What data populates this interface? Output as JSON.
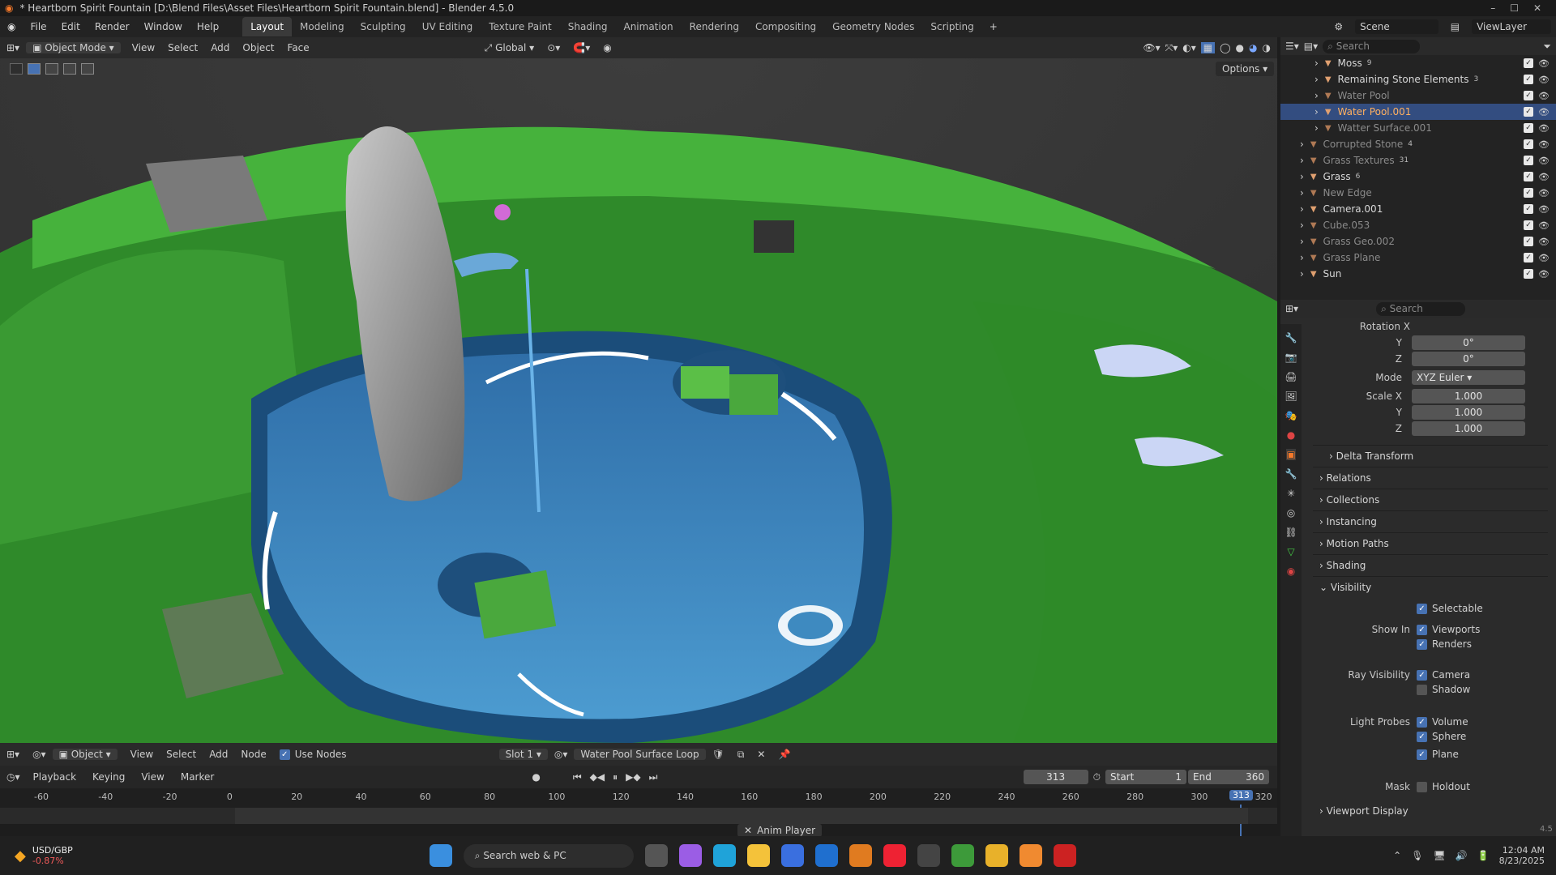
{
  "window": {
    "title": "* Heartborn Spirit Fountain [D:\\Blend Files\\Asset Files\\Heartborn Spirit Fountain.blend] - Blender 4.5.0"
  },
  "menu": [
    "File",
    "Edit",
    "Render",
    "Window",
    "Help"
  ],
  "workspaces": [
    "Layout",
    "Modeling",
    "Sculpting",
    "UV Editing",
    "Texture Paint",
    "Shading",
    "Animation",
    "Rendering",
    "Compositing",
    "Geometry Nodes",
    "Scripting"
  ],
  "active_workspace": "Layout",
  "scene": {
    "name": "Scene",
    "view_layer": "ViewLayer"
  },
  "viewport_header": {
    "mode": "Object Mode",
    "menus": [
      "View",
      "Select",
      "Add",
      "Object",
      "Face"
    ],
    "orientation": "Global",
    "options": "Options"
  },
  "outliner": {
    "search_placeholder": "Search",
    "items": [
      {
        "label": "Moss",
        "indent": 2,
        "dim": false,
        "badge": "9"
      },
      {
        "label": "Remaining Stone Elements",
        "indent": 2,
        "dim": false,
        "badge": "3"
      },
      {
        "label": "Water Pool",
        "indent": 2,
        "dim": true,
        "badge": ""
      },
      {
        "label": "Water Pool.001",
        "indent": 2,
        "dim": false,
        "badge": "",
        "selected": true
      },
      {
        "label": "Watter Surface.001",
        "indent": 2,
        "dim": true,
        "badge": ""
      },
      {
        "label": "Corrupted Stone",
        "indent": 1,
        "dim": true,
        "badge": "4"
      },
      {
        "label": "Grass Textures",
        "indent": 1,
        "dim": true,
        "badge": "31"
      },
      {
        "label": "Grass",
        "indent": 1,
        "dim": false,
        "badge": "6"
      },
      {
        "label": "New Edge",
        "indent": 1,
        "dim": true,
        "badge": ""
      },
      {
        "label": "Camera.001",
        "indent": 1,
        "dim": false,
        "badge": ""
      },
      {
        "label": "Cube.053",
        "indent": 1,
        "dim": true,
        "badge": ""
      },
      {
        "label": "Grass Geo.002",
        "indent": 1,
        "dim": true,
        "badge": ""
      },
      {
        "label": "Grass Plane",
        "indent": 1,
        "dim": true,
        "badge": ""
      },
      {
        "label": "Sun",
        "indent": 1,
        "dim": false,
        "badge": ""
      }
    ]
  },
  "properties": {
    "search_placeholder": "Search",
    "rotation_label": "Rotation X",
    "rot_y": {
      "label": "Y",
      "value": "0°"
    },
    "rot_z": {
      "label": "Z",
      "value": "0°"
    },
    "mode": {
      "label": "Mode",
      "value": "XYZ Euler"
    },
    "scale_x": {
      "label": "Scale X",
      "value": "1.000"
    },
    "scale_y": {
      "label": "Y",
      "value": "1.000"
    },
    "scale_z": {
      "label": "Z",
      "value": "1.000"
    },
    "panels": [
      "Delta Transform",
      "Relations",
      "Collections",
      "Instancing",
      "Motion Paths",
      "Shading",
      "Visibility"
    ],
    "visibility": {
      "selectable": "Selectable",
      "show_in": "Show In",
      "viewports": "Viewports",
      "renders": "Renders",
      "ray_visibility": "Ray Visibility",
      "camera": "Camera",
      "shadow": "Shadow",
      "light_probes": "Light Probes",
      "volume": "Volume",
      "sphere": "Sphere",
      "plane": "Plane",
      "mask": "Mask",
      "holdout": "Holdout"
    },
    "viewport_display": "Viewport Display"
  },
  "shader_header": {
    "object": "Object",
    "menus": [
      "View",
      "Select",
      "Add",
      "Node"
    ],
    "use_nodes": "Use Nodes",
    "slot": "Slot 1",
    "material": "Water Pool Surface Loop"
  },
  "timeline": {
    "menus": [
      "Playback",
      "Keying",
      "View",
      "Marker"
    ],
    "current_frame": "313",
    "start_label": "Start",
    "start": "1",
    "end_label": "End",
    "end": "360",
    "ticks": [
      "-60",
      "-40",
      "-20",
      "0",
      "20",
      "40",
      "60",
      "80",
      "100",
      "120",
      "140",
      "160",
      "180",
      "200",
      "220",
      "240",
      "260",
      "280",
      "300",
      "320"
    ],
    "playhead": "313",
    "anim_player": "Anim Player"
  },
  "taskbar": {
    "ticker": "USD/GBP",
    "change": "-0.87%",
    "search": "Search web & PC",
    "time": "12:04 AM",
    "date": "8/23/2025"
  },
  "status_version": "4.5"
}
